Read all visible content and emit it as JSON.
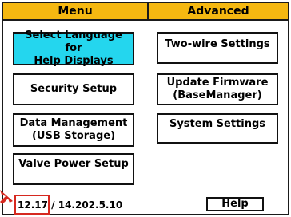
{
  "tabs": {
    "menu": "Menu",
    "advanced": "Advanced"
  },
  "left_buttons": [
    {
      "label": "Select Language for\nHelp Displays",
      "active": true
    },
    {
      "label": "Security Setup",
      "active": false
    },
    {
      "label": "Data Management\n(USB Storage)",
      "active": false
    },
    {
      "label": "Valve Power Setup",
      "active": false
    }
  ],
  "right_buttons": [
    {
      "label": "Two-wire Settings"
    },
    {
      "label": "Update Firmware\n(BaseManager)"
    },
    {
      "label": "System Settings"
    }
  ],
  "footer": {
    "version_highlight": "12.17",
    "version_rest": "14.202.5.10",
    "help_label": "Help"
  },
  "colors": {
    "header": "#f5b811",
    "active_button": "#24d6ee",
    "highlight": "#d6281f"
  }
}
